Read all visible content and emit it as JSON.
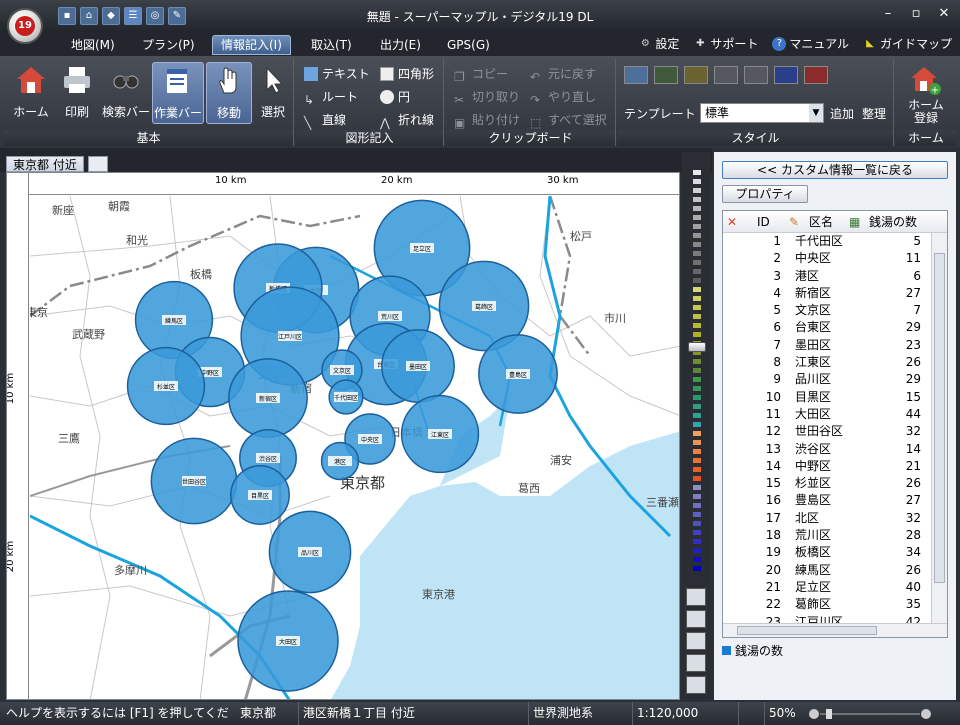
{
  "window": {
    "title": "無題 - スーパーマップル・デジタル19 DL",
    "logo_text": "19"
  },
  "menu": {
    "tabs": [
      {
        "label": "地図(M)"
      },
      {
        "label": "プラン(P)"
      },
      {
        "label": "情報記入(I)"
      },
      {
        "label": "取込(T)"
      },
      {
        "label": "出力(E)"
      },
      {
        "label": "GPS(G)"
      }
    ],
    "active_tab": "情報記入(I)",
    "help_links": {
      "settings": "設定",
      "support": "サポート",
      "manual": "マニュアル",
      "guidemap": "ガイドマップ"
    }
  },
  "ribbon": {
    "basic": {
      "label": "基本",
      "home": "ホーム",
      "print": "印刷",
      "searchbar": "検索バー",
      "workbar": "作業バー",
      "move": "移動",
      "select": "選択"
    },
    "shapes": {
      "label": "図形記入",
      "text": "テキスト",
      "route": "ルート",
      "line": "直線",
      "rect": "四角形",
      "circle": "円",
      "polyline": "折れ線"
    },
    "clipboard": {
      "label": "クリップボード",
      "copy": "コピー",
      "cut": "切り取り",
      "paste": "貼り付け",
      "undo": "元に戻す",
      "redo": "やり直し",
      "select_all": "すべて選択"
    },
    "style": {
      "label": "スタイル",
      "template_label": "テンプレート",
      "template_value": "標準",
      "add": "追加",
      "organize": "整理"
    },
    "home_group": {
      "label": "ホーム",
      "register": "ホーム\n登録"
    }
  },
  "document": {
    "tab_label": "東京都 付近"
  },
  "map": {
    "scale_ticks_top": [
      "10 km",
      "20 km",
      "30 km"
    ],
    "scale_ticks_left": [
      "10 km",
      "20 km"
    ],
    "places": [
      {
        "name": "新座"
      },
      {
        "name": "朝霞"
      },
      {
        "name": "和光"
      },
      {
        "name": "板橋"
      },
      {
        "name": "東京"
      },
      {
        "name": "武蔵野"
      },
      {
        "name": "三鷹"
      },
      {
        "name": "東京"
      },
      {
        "name": "新宿"
      },
      {
        "name": "東京都"
      },
      {
        "name": "松戸"
      },
      {
        "name": "市川"
      },
      {
        "name": "浦安"
      },
      {
        "name": "葛西"
      },
      {
        "name": "多摩川"
      },
      {
        "name": "東京港"
      },
      {
        "name": "日本橋"
      },
      {
        "name": "三番瀬"
      }
    ],
    "bubbles": [
      {
        "label": "足立区",
        "value": 40
      },
      {
        "label": "北区",
        "value": 32
      },
      {
        "label": "板橋区",
        "value": 34
      },
      {
        "label": "荒川区",
        "value": 28
      },
      {
        "label": "葛飾区",
        "value": 35
      },
      {
        "label": "練馬区",
        "value": 26
      },
      {
        "label": "豊島区",
        "value": 27
      },
      {
        "label": "江戸川区",
        "value": 42
      },
      {
        "label": "中野区",
        "value": 21
      },
      {
        "label": "台東区",
        "value": 29
      },
      {
        "label": "墨田区",
        "value": 23
      },
      {
        "label": "文京区",
        "value": 7
      },
      {
        "label": "杉並区",
        "value": 26
      },
      {
        "label": "新宿区",
        "value": 27
      },
      {
        "label": "千代田区",
        "value": 5
      },
      {
        "label": "江東区",
        "value": 26
      },
      {
        "label": "中央区",
        "value": 11
      },
      {
        "label": "渋谷区",
        "value": 14
      },
      {
        "label": "港区",
        "value": 6
      },
      {
        "label": "世田谷区",
        "value": 32
      },
      {
        "label": "目黒区",
        "value": 15
      },
      {
        "label": "品川区",
        "value": 29
      },
      {
        "label": "大田区",
        "value": 44
      }
    ]
  },
  "panel": {
    "back_button": "<< カスタム情報一覧に戻る",
    "property_button": "プロパティ",
    "columns": {
      "id": "ID",
      "name": "区名",
      "value": "銭湯の数"
    },
    "rows": [
      {
        "id": "1",
        "name": "千代田区",
        "value": "5"
      },
      {
        "id": "2",
        "name": "中央区",
        "value": "11"
      },
      {
        "id": "3",
        "name": "港区",
        "value": "6"
      },
      {
        "id": "4",
        "name": "新宿区",
        "value": "27"
      },
      {
        "id": "5",
        "name": "文京区",
        "value": "7"
      },
      {
        "id": "6",
        "name": "台東区",
        "value": "29"
      },
      {
        "id": "7",
        "name": "墨田区",
        "value": "23"
      },
      {
        "id": "8",
        "name": "江東区",
        "value": "26"
      },
      {
        "id": "9",
        "name": "品川区",
        "value": "29"
      },
      {
        "id": "10",
        "name": "目黒区",
        "value": "15"
      },
      {
        "id": "11",
        "name": "大田区",
        "value": "44"
      },
      {
        "id": "12",
        "name": "世田谷区",
        "value": "32"
      },
      {
        "id": "13",
        "name": "渋谷区",
        "value": "14"
      },
      {
        "id": "14",
        "name": "中野区",
        "value": "21"
      },
      {
        "id": "15",
        "name": "杉並区",
        "value": "26"
      },
      {
        "id": "16",
        "name": "豊島区",
        "value": "27"
      },
      {
        "id": "17",
        "name": "北区",
        "value": "32"
      },
      {
        "id": "18",
        "name": "荒川区",
        "value": "28"
      },
      {
        "id": "19",
        "name": "板橋区",
        "value": "34"
      },
      {
        "id": "20",
        "name": "練馬区",
        "value": "26"
      },
      {
        "id": "21",
        "name": "足立区",
        "value": "40"
      },
      {
        "id": "22",
        "name": "葛飾区",
        "value": "35"
      },
      {
        "id": "23",
        "name": "江戸川区",
        "value": "42"
      }
    ],
    "legend": "銭湯の数",
    "legend_color": "#1a7ad4"
  },
  "status": {
    "help": "ヘルプを表示するには [F1] を押してくだ",
    "pref": "東京都",
    "address": "港区新橋１丁目 付近",
    "datum": "世界測地系",
    "scale": "1:120,000",
    "zoom": "50%"
  },
  "colors": {
    "bubble_fill": "#3a9ad9",
    "bubble_stroke": "#1b5f9c",
    "water": "#bfe4f6",
    "river": "#1aa3dd"
  }
}
